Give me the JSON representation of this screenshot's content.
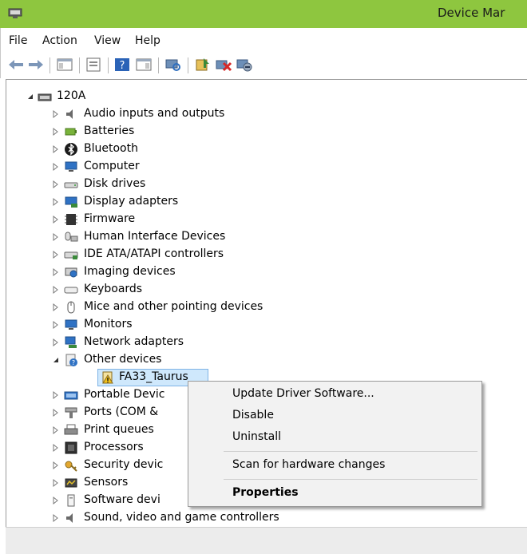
{
  "window": {
    "title": "Device Mar"
  },
  "menu": [
    "File",
    "Action",
    "View",
    "Help"
  ],
  "toolbar": {
    "buttons": [
      "back-arrow-icon",
      "forward-arrow-icon",
      "show-hide-console-tree-icon",
      "properties-icon",
      "help-icon",
      "action-pane-icon",
      "scan-hardware-icon",
      "update-driver-icon",
      "uninstall-device-icon",
      "disable-device-icon"
    ]
  },
  "tree": {
    "root": "120A",
    "categories": [
      "Audio inputs and outputs",
      "Batteries",
      "Bluetooth",
      "Computer",
      "Disk drives",
      "Display adapters",
      "Firmware",
      "Human Interface Devices",
      "IDE ATA/ATAPI controllers",
      "Imaging devices",
      "Keyboards",
      "Mice and other pointing devices",
      "Monitors",
      "Network adapters",
      "Other devices",
      "FA33_Taurus",
      "Portable Devic",
      "Ports (COM &",
      "Print queues",
      "Processors",
      "Security devic",
      "Sensors",
      "Software devi",
      "Sound, video and game controllers"
    ]
  },
  "context_menu": {
    "items": [
      "Update Driver Software...",
      "Disable",
      "Uninstall",
      "Scan for hardware changes",
      "Properties"
    ]
  }
}
